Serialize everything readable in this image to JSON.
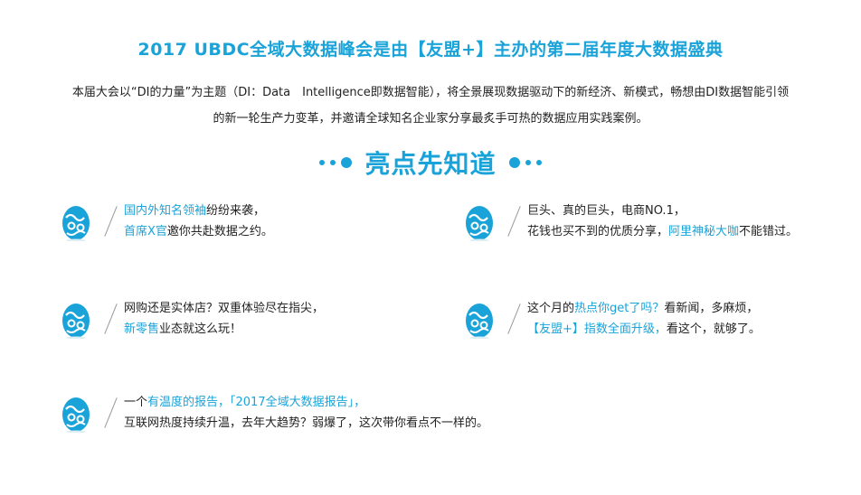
{
  "header": {
    "title": "2017 UBDC全域大数据峰会是由【友盟+】主办的第二届年度大数据盛典",
    "intro_line1": "本届大会以“DI的力量”为主题（DI：Data　Intelligence即数据智能），将全景展现数据驱动下的新经济、新模式，畅想由DI数据智能引领",
    "intro_line2": "的新一轮生产力变革，并邀请全球知名企业家分享最炙手可热的数据应用实践案例。"
  },
  "section": {
    "heading": "亮点先知道"
  },
  "colors": {
    "accent": "#1aa3d9",
    "text": "#222222"
  },
  "features": [
    {
      "icon": "easter-egg-icon",
      "line1_highlight": "国内外知名领袖",
      "line1_rest": "纷纷来袭，",
      "line2_highlight": "首席X官",
      "line2_rest": "邀你共赴数据之约。"
    },
    {
      "icon": "easter-egg-icon",
      "line1": "巨头、真的巨头，电商NO.1，",
      "line2_pre": "花钱也买不到的优质分享，",
      "line2_highlight": "阿里神秘大咖",
      "line2_post": "不能错过。"
    },
    {
      "icon": "easter-egg-icon",
      "line1": "网购还是实体店？双重体验尽在指尖，",
      "line2_highlight": "新零售",
      "line2_rest": "业态就这么玩！"
    },
    {
      "icon": "easter-egg-icon",
      "line1_pre": "这个月的",
      "line1_highlight": "热点你get了吗？",
      "line1_post": "看新闻，多麻烦，",
      "line2_highlight": "【友盟+】指数全面升级，",
      "line2_rest": "看这个，就够了。"
    },
    {
      "icon": "easter-egg-icon",
      "line1_pre": "一个",
      "line1_highlight": "有温度的报告，「2017全域大数据报告」，",
      "line2": "互联网热度持续升温，去年大趋势？弱爆了，这次带你看点不一样的。"
    }
  ]
}
